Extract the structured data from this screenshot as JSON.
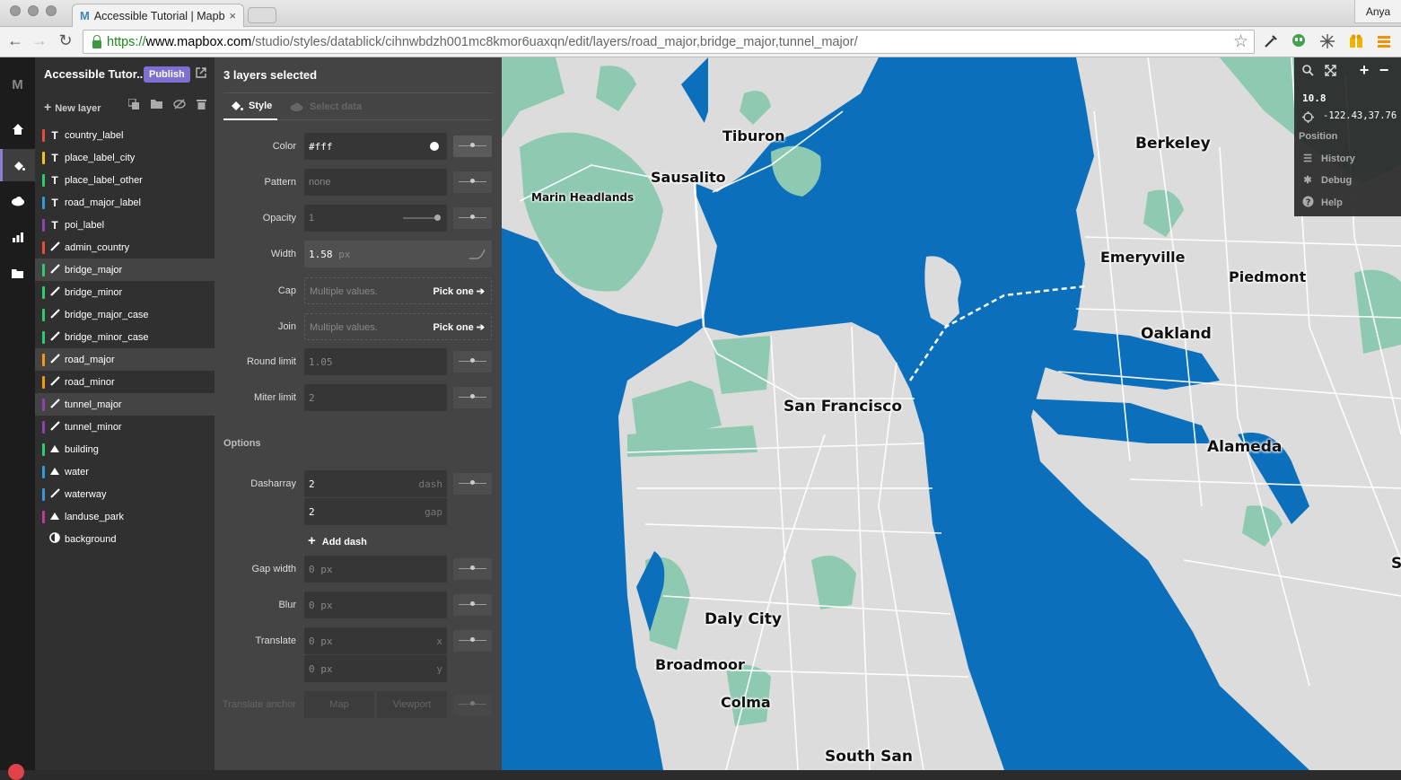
{
  "browser": {
    "tab_title": "Accessible Tutorial | Mapb",
    "tab_logo": "M",
    "tab_close": "×",
    "user": "Anya",
    "url_scheme": "https://",
    "url_host": "www.mapbox.com",
    "url_path": "/studio/styles/datablick/cihnwbdzh001mc8kmor6uaxqn/edit/layers/road_major,bridge_major,tunnel_major/",
    "star": "☆",
    "back": "←",
    "forward": "→",
    "reload": "↻"
  },
  "nav": {
    "brand": "M",
    "icons": [
      "home-icon",
      "paint-icon",
      "cloud-icon",
      "stats-icon",
      "folder-icon"
    ],
    "active": "paint-icon"
  },
  "sidebar": {
    "project_title": "Accessible Tutor...",
    "publish_label": "Publish",
    "new_layer_label": "New layer",
    "layers": [
      {
        "name": "country_label",
        "type": "T",
        "color": "#e74c3c",
        "selected": false
      },
      {
        "name": "place_label_city",
        "type": "T",
        "color": "#f1c40f",
        "selected": false
      },
      {
        "name": "place_label_other",
        "type": "T",
        "color": "#2ecc71",
        "selected": false
      },
      {
        "name": "road_major_label",
        "type": "T",
        "color": "#3498db",
        "selected": false
      },
      {
        "name": "poi_label",
        "type": "T",
        "color": "#8e44ad",
        "selected": false
      },
      {
        "name": "admin_country",
        "type": "line",
        "color": "#e74c3c",
        "selected": false
      },
      {
        "name": "bridge_major",
        "type": "line",
        "color": "#2ecc71",
        "selected": true
      },
      {
        "name": "bridge_minor",
        "type": "line",
        "color": "#2ecc71",
        "selected": false
      },
      {
        "name": "bridge_major_case",
        "type": "line",
        "color": "#2ecc71",
        "selected": false
      },
      {
        "name": "bridge_minor_case",
        "type": "line",
        "color": "#2ecc71",
        "selected": false
      },
      {
        "name": "road_major",
        "type": "line",
        "color": "#f39c12",
        "selected": true
      },
      {
        "name": "road_minor",
        "type": "line",
        "color": "#f39c12",
        "selected": false
      },
      {
        "name": "tunnel_major",
        "type": "line",
        "color": "#8e44ad",
        "selected": true
      },
      {
        "name": "tunnel_minor",
        "type": "line",
        "color": "#8e44ad",
        "selected": false
      },
      {
        "name": "building",
        "type": "fill",
        "color": "#2ecc71",
        "selected": false
      },
      {
        "name": "water",
        "type": "fill",
        "color": "#3498db",
        "selected": false
      },
      {
        "name": "waterway",
        "type": "line",
        "color": "#3498db",
        "selected": false
      },
      {
        "name": "landuse_park",
        "type": "fill",
        "color": "#c0399a",
        "selected": false
      },
      {
        "name": "background",
        "type": "bg",
        "color": "#303030",
        "selected": false
      }
    ]
  },
  "panel": {
    "heading": "3 layers selected",
    "tab_style": "Style",
    "tab_data": "Select data",
    "color_label": "Color",
    "color_value": "#fff",
    "pattern_label": "Pattern",
    "pattern_value": "none",
    "opacity_label": "Opacity",
    "opacity_value": "1",
    "width_label": "Width",
    "width_value": "1.58",
    "width_unit": "px",
    "cap_label": "Cap",
    "cap_value": "Multiple values.",
    "cap_pick": "Pick one",
    "join_label": "Join",
    "join_value": "Multiple values.",
    "join_pick": "Pick one",
    "round_label": "Round limit",
    "round_value": "1.05",
    "miter_label": "Miter limit",
    "miter_value": "2",
    "options_label": "Options",
    "dash_label": "Dasharray",
    "dash_value": "2",
    "dash_unit": "dash",
    "gap_value": "2",
    "gap_unit": "gap",
    "add_dash": "Add dash",
    "gapwidth_label": "Gap width",
    "gapwidth_placeholder": "0 px",
    "blur_label": "Blur",
    "blur_placeholder": "0 px",
    "translate_label": "Translate",
    "translate_x": "0 px",
    "translate_x_axis": "x",
    "translate_y": "0 px",
    "translate_y_axis": "y",
    "anchor_label": "Translate anchor",
    "anchor_map": "Map",
    "anchor_viewport": "Viewport"
  },
  "map": {
    "zoom": "10.8",
    "coords": "-122.43,37.76",
    "position_label": "Position",
    "menu": [
      "History",
      "Debug",
      "Help"
    ],
    "labels": [
      "Tiburon",
      "Sausalito",
      "Marin Headlands",
      "Berkeley",
      "Emeryville",
      "Piedmont",
      "Oakland",
      "San Francisco",
      "Alameda",
      "Daly City",
      "Broadmoor",
      "Colma",
      "South San",
      "S"
    ],
    "water_color": "#0b6fbb",
    "land_color": "#dcdcdc",
    "park_color": "#8ec9b1"
  }
}
